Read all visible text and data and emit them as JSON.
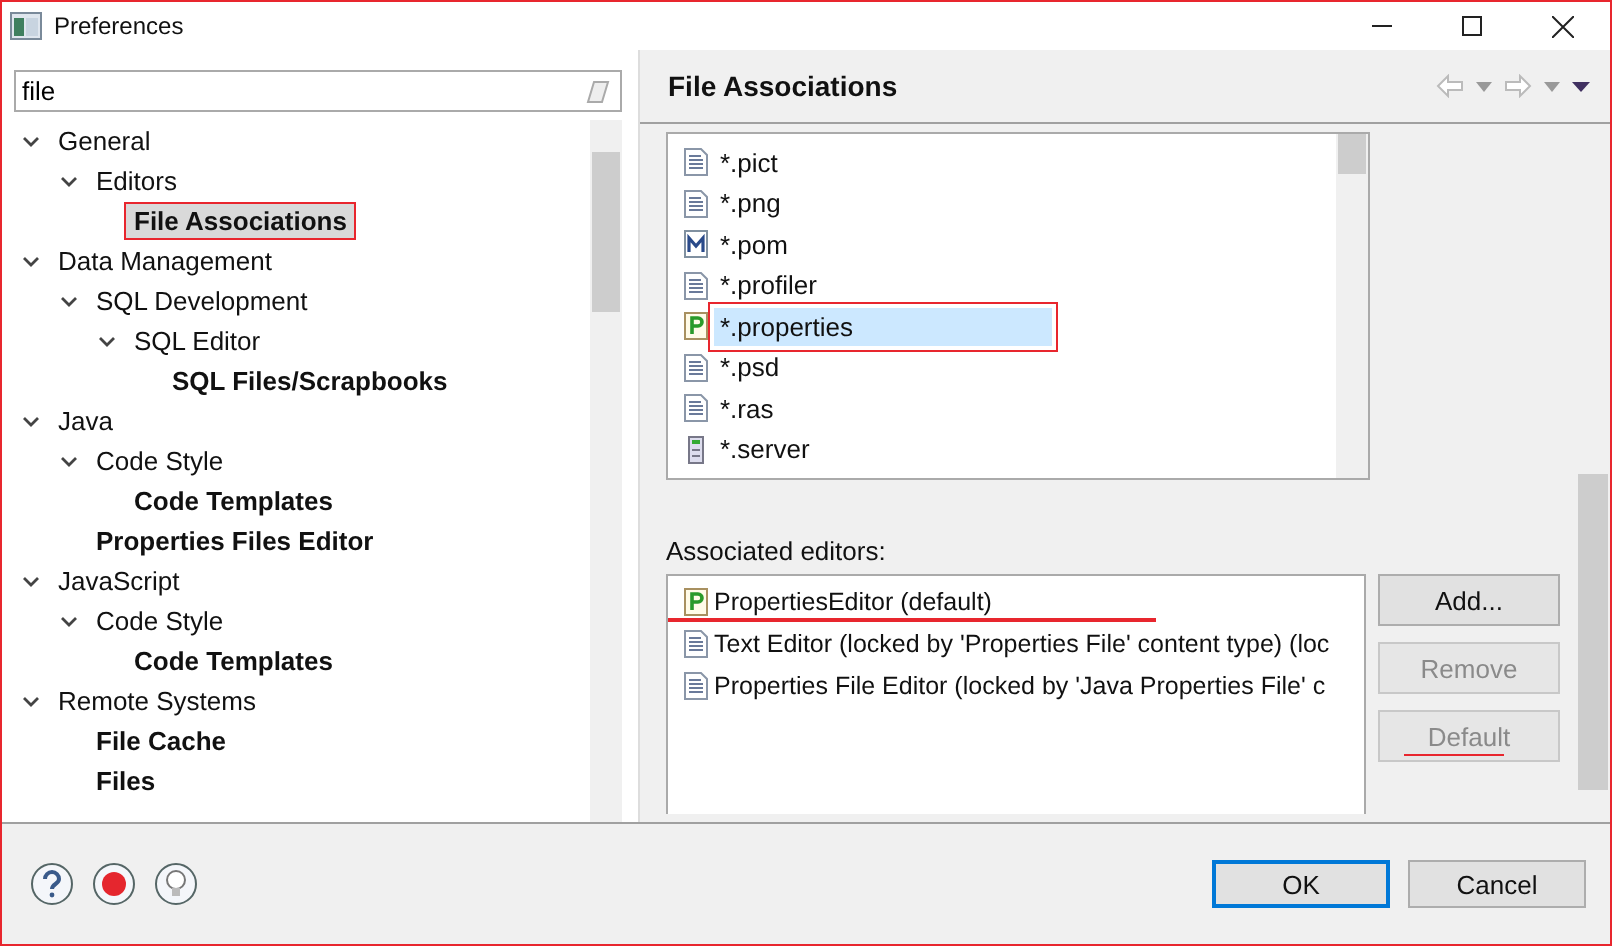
{
  "window": {
    "title": "Preferences"
  },
  "filter": {
    "value": "file"
  },
  "tree": [
    {
      "label": "General",
      "expanded": true,
      "match": false,
      "selected": false,
      "children": [
        {
          "label": "Editors",
          "expanded": true,
          "match": false,
          "selected": false,
          "children": [
            {
              "label": "File Associations",
              "match": true,
              "selected": true,
              "marked": true
            }
          ]
        }
      ]
    },
    {
      "label": "Data Management",
      "expanded": true,
      "match": false,
      "selected": false,
      "children": [
        {
          "label": "SQL Development",
          "expanded": true,
          "match": false,
          "selected": false,
          "children": [
            {
              "label": "SQL Editor",
              "expanded": true,
              "match": false,
              "selected": false,
              "children": [
                {
                  "label": "SQL Files/Scrapbooks",
                  "match": true,
                  "selected": false
                }
              ]
            }
          ]
        }
      ]
    },
    {
      "label": "Java",
      "expanded": true,
      "match": false,
      "selected": false,
      "children": [
        {
          "label": "Code Style",
          "expanded": true,
          "match": false,
          "selected": false,
          "children": [
            {
              "label": "Code Templates",
              "match": true,
              "selected": false
            }
          ]
        },
        {
          "label": "Properties Files Editor",
          "match": true,
          "selected": false
        }
      ]
    },
    {
      "label": "JavaScript",
      "expanded": true,
      "match": false,
      "selected": false,
      "children": [
        {
          "label": "Code Style",
          "expanded": true,
          "match": false,
          "selected": false,
          "children": [
            {
              "label": "Code Templates",
              "match": true,
              "selected": false
            }
          ]
        }
      ]
    },
    {
      "label": "Remote Systems",
      "expanded": true,
      "match": false,
      "selected": false,
      "children": [
        {
          "label": "File Cache",
          "match": true,
          "selected": false
        },
        {
          "label": "Files",
          "match": true,
          "selected": false
        }
      ]
    }
  ],
  "page": {
    "title": "File Associations"
  },
  "file_types": [
    {
      "label": "*.pict",
      "kind": "text",
      "selected": false,
      "marked": false
    },
    {
      "label": "*.png",
      "kind": "text",
      "selected": false,
      "marked": false
    },
    {
      "label": "*.pom",
      "kind": "maven",
      "selected": false,
      "marked": false
    },
    {
      "label": "*.profiler",
      "kind": "text",
      "selected": false,
      "marked": false
    },
    {
      "label": "*.properties",
      "kind": "properties",
      "selected": true,
      "marked": true
    },
    {
      "label": "*.psd",
      "kind": "text",
      "selected": false,
      "marked": false
    },
    {
      "label": "*.ras",
      "kind": "text",
      "selected": false,
      "marked": false
    },
    {
      "label": "*.server",
      "kind": "server",
      "selected": false,
      "marked": false
    }
  ],
  "editors_label": "Associated editors:",
  "editors": [
    {
      "label": "PropertiesEditor (default)",
      "kind": "properties",
      "marked": true
    },
    {
      "label": "Text Editor (locked by 'Properties File' content type) (loc",
      "kind": "text"
    },
    {
      "label": "Properties File Editor (locked by 'Java Properties File' c",
      "kind": "text"
    }
  ],
  "editor_buttons": [
    {
      "label": "Add...",
      "disabled": false,
      "marked": false
    },
    {
      "label": "Remove",
      "disabled": true,
      "marked": false
    },
    {
      "label": "Default",
      "disabled": true,
      "marked": true
    }
  ],
  "dialog_buttons": [
    {
      "label": "OK",
      "default": true
    },
    {
      "label": "Cancel",
      "default": false
    }
  ]
}
